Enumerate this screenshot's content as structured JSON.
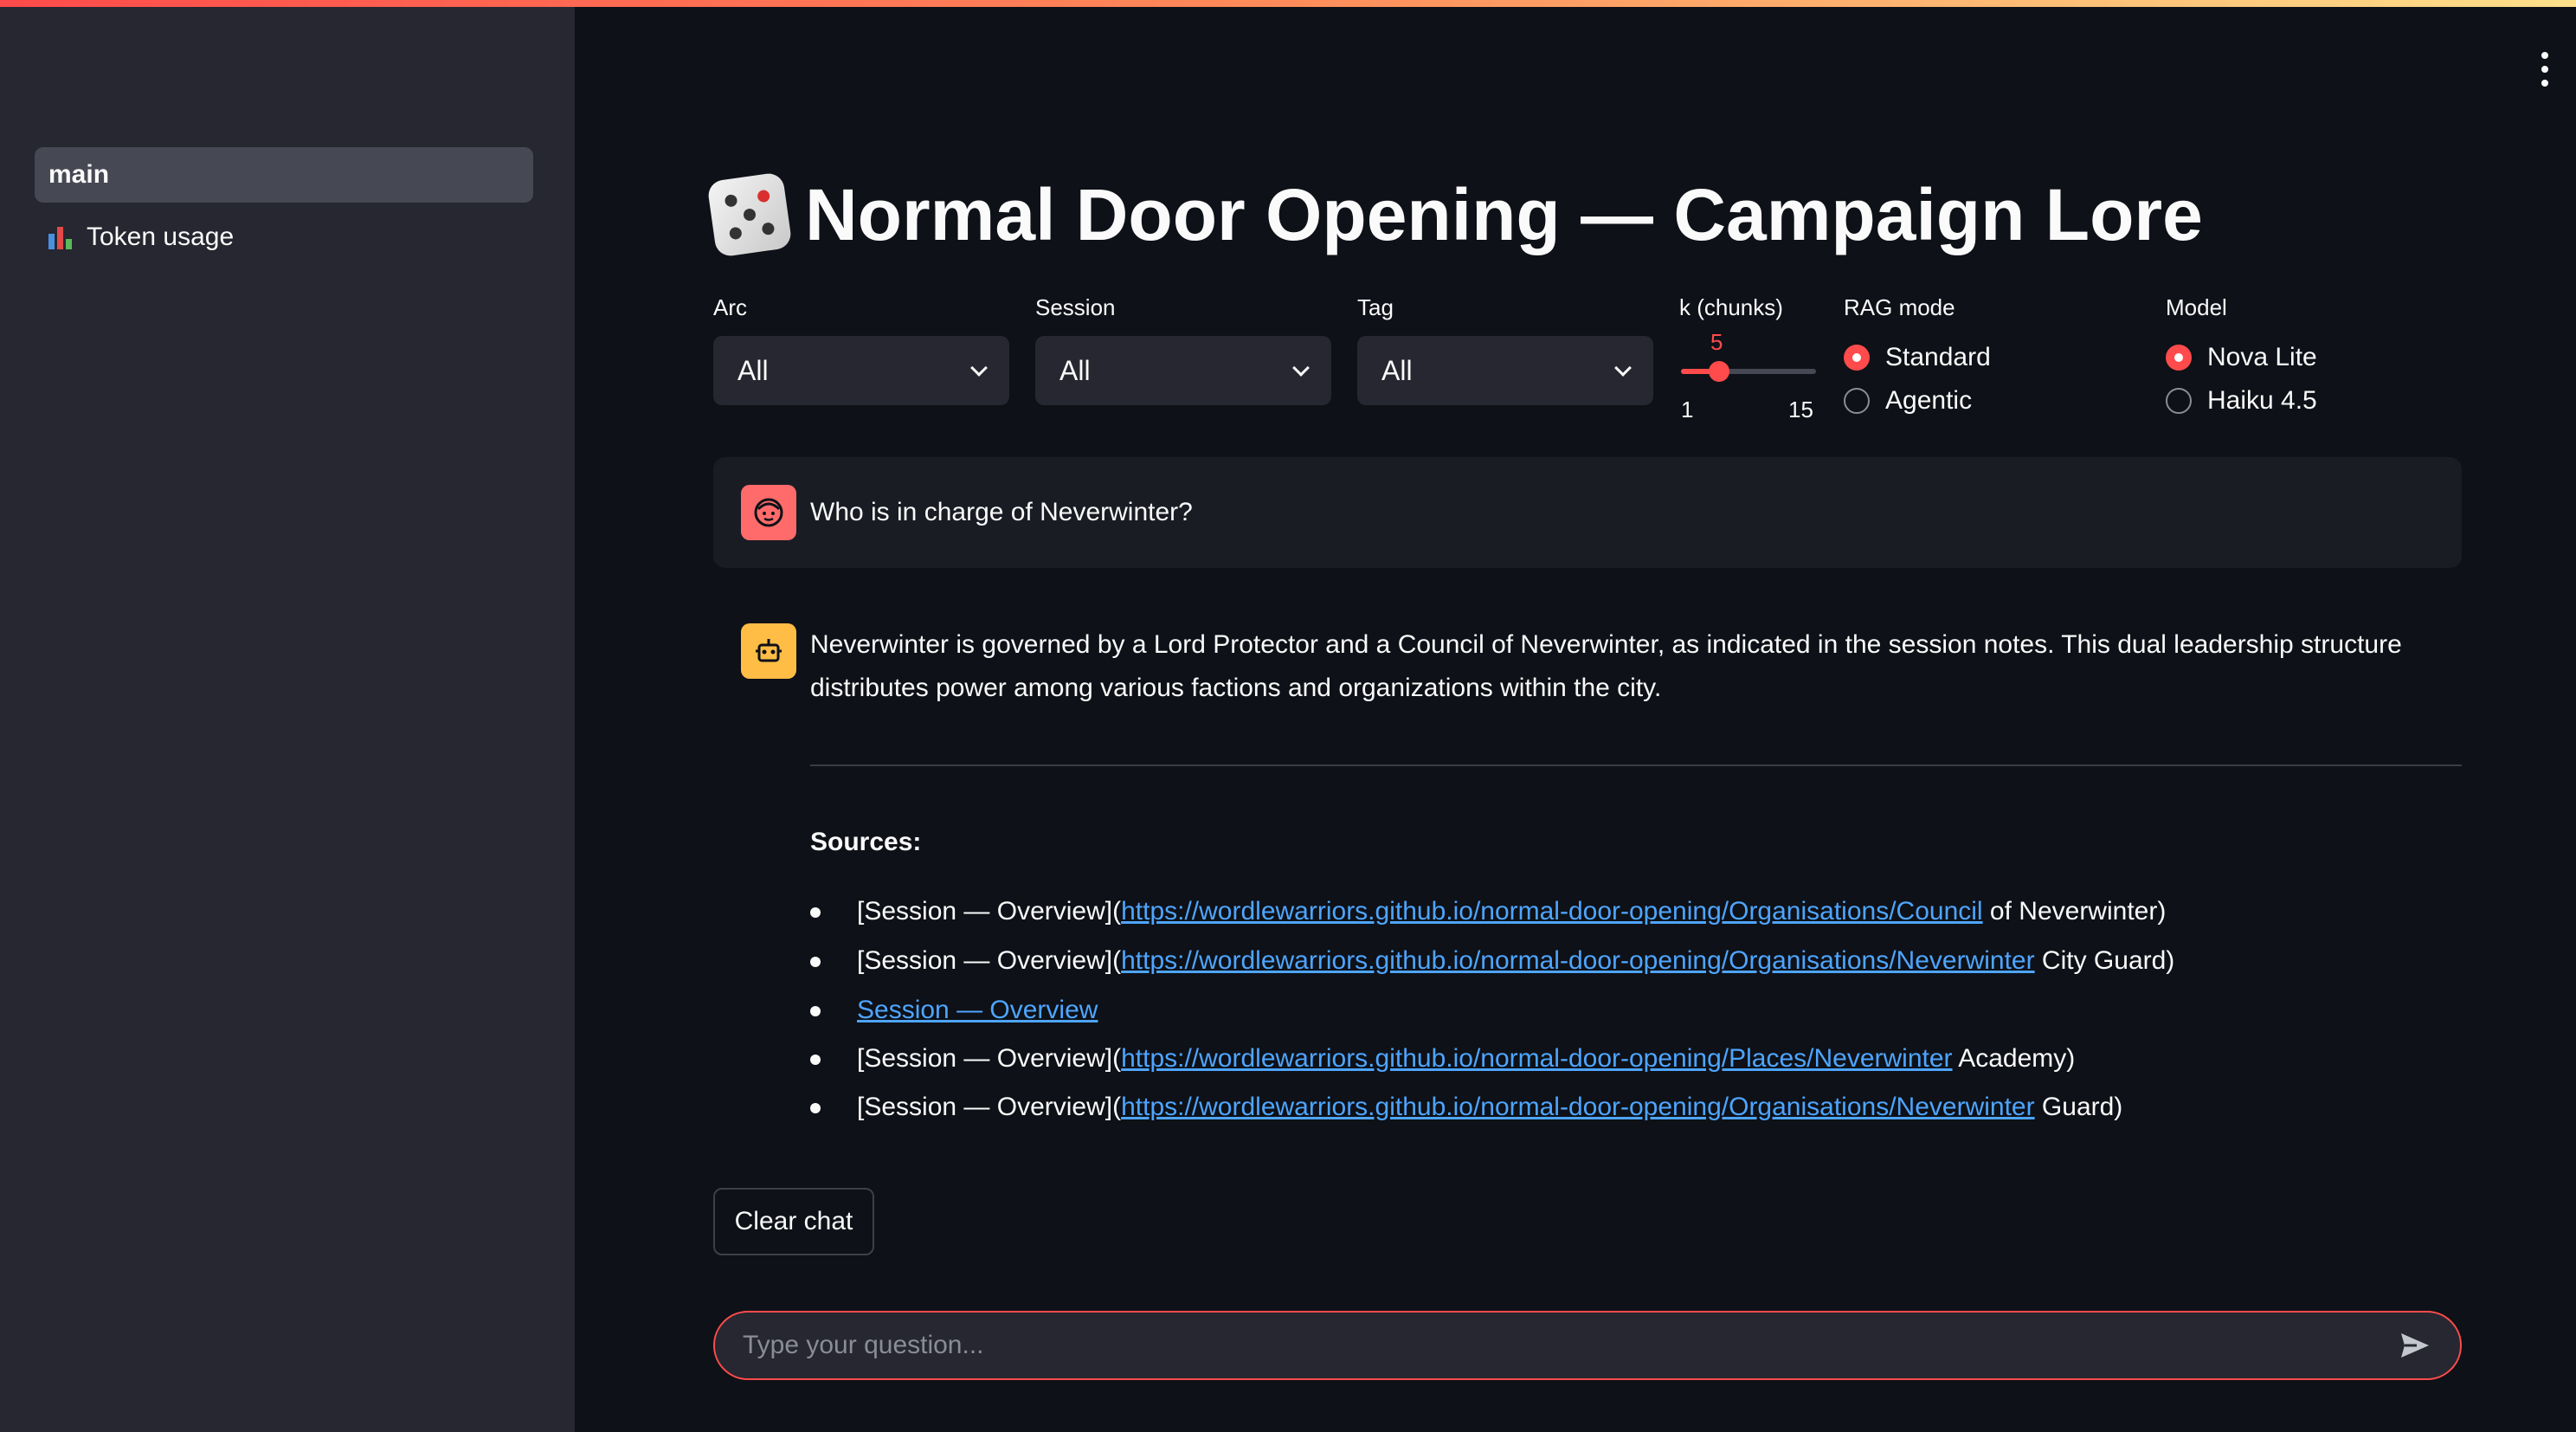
{
  "app": {
    "title": "Normal Door Opening — Campaign Lore",
    "title_icon": "dice-icon"
  },
  "sidebar": {
    "items": [
      {
        "label": "main",
        "active": true
      },
      {
        "label": "Token usage",
        "icon": "bar-chart-icon",
        "active": false
      }
    ]
  },
  "filters": {
    "arc": {
      "label": "Arc",
      "value": "All"
    },
    "session": {
      "label": "Session",
      "value": "All"
    },
    "tag": {
      "label": "Tag",
      "value": "All"
    },
    "k": {
      "label": "k (chunks)",
      "value": "5",
      "min": "1",
      "max": "15",
      "fraction": 0.2857
    },
    "rag_mode": {
      "label": "RAG mode",
      "options": [
        "Standard",
        "Agentic"
      ],
      "selected": "Standard"
    },
    "model": {
      "label": "Model",
      "options": [
        "Nova Lite",
        "Haiku 4.5"
      ],
      "selected": "Nova Lite"
    }
  },
  "chat": {
    "user_message": "Who is in charge of Neverwinter?",
    "assistant_line1": "Neverwinter is governed by a Lord Protector and a Council of Neverwinter, as indicated in the session notes. This dual leadership structure",
    "assistant_line2": "distributes power among various factions and organizations within the city.",
    "sources_title": "Sources:",
    "sources": [
      {
        "prefix": "[Session — Overview](",
        "link": "https://wordlewarriors.github.io/normal-door-opening/Organisations/Council",
        "suffix": " of Neverwinter)"
      },
      {
        "prefix": "[Session — Overview](",
        "link": "https://wordlewarriors.github.io/normal-door-opening/Organisations/Neverwinter",
        "suffix": " City Guard)"
      },
      {
        "prefix": "",
        "link": "Session — Overview",
        "suffix": ""
      },
      {
        "prefix": "[Session — Overview](",
        "link": "https://wordlewarriors.github.io/normal-door-opening/Places/Neverwinter",
        "suffix": " Academy)"
      },
      {
        "prefix": "[Session — Overview](",
        "link": "https://wordlewarriors.github.io/normal-door-opening/Organisations/Neverwinter",
        "suffix": " Guard)"
      }
    ]
  },
  "actions": {
    "clear_chat": "Clear chat"
  },
  "input": {
    "placeholder": "Type your question..."
  },
  "colors": {
    "accent": "#ff4b4b",
    "link": "#4ea5ff",
    "background": "#0e1117",
    "sidebar": "#262730"
  }
}
